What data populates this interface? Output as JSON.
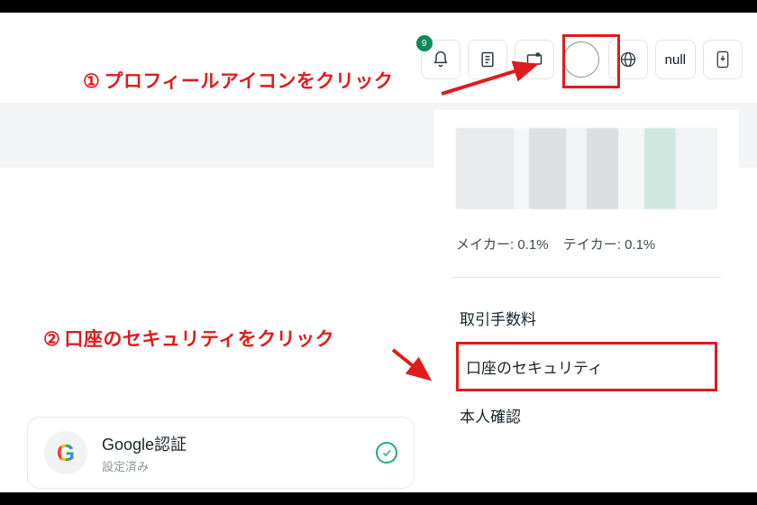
{
  "header": {
    "notification_badge": "9",
    "null_label": "null"
  },
  "annotations": {
    "step1_num": "①",
    "step1_text": "プロフィールアイコンをクリック",
    "step2_num": "②",
    "step2_text": "口座のセキュリティをクリック"
  },
  "dropdown": {
    "maker_label": "メイカー:",
    "maker_value": "0.1%",
    "taker_label": "テイカー:",
    "taker_value": "0.1%",
    "items": {
      "fees": "取引手数料",
      "security": "口座のセキュリティ",
      "kyc": "本人確認"
    }
  },
  "google_card": {
    "letter": "G",
    "title": "Google認証",
    "subtitle": "設定済み"
  }
}
